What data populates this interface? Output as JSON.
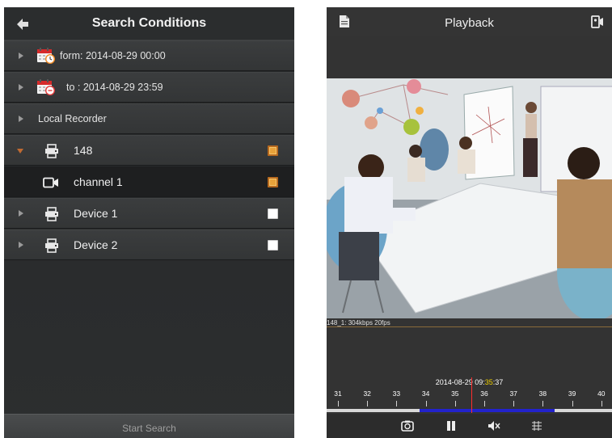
{
  "search": {
    "title": "Search Conditions",
    "from_label": "form: 2014-08-29 00:00",
    "to_label": "to  : 2014-08-29 23:59",
    "local_recorder": "Local Recorder",
    "device_148": "148",
    "channel_1": "channel 1",
    "device_1": "Device 1",
    "device_2": "Device 2",
    "start_button": "Start Search",
    "checks": {
      "device_148": true,
      "channel_1": true,
      "device_1": false,
      "device_2": false
    }
  },
  "playback": {
    "title": "Playback",
    "video_info": "148_1: 304kbps 20fps",
    "timeline": {
      "date_prefix": "2014-08-29  09:",
      "minute": "35",
      "seconds": ":37",
      "ticks": [
        "31",
        "32",
        "33",
        "34",
        "35",
        "36",
        "37",
        "38",
        "39",
        "40"
      ],
      "recorded_range": [
        33.8,
        38.4
      ]
    },
    "controls": [
      "snapshot-icon",
      "pause-icon",
      "mute-icon",
      "grid-icon"
    ]
  },
  "colors": {
    "accent_orange": "#e8a23a",
    "timeline_fill": "#2222cc",
    "cursor": "#ff2d2d",
    "highlight": "#f0d000"
  }
}
